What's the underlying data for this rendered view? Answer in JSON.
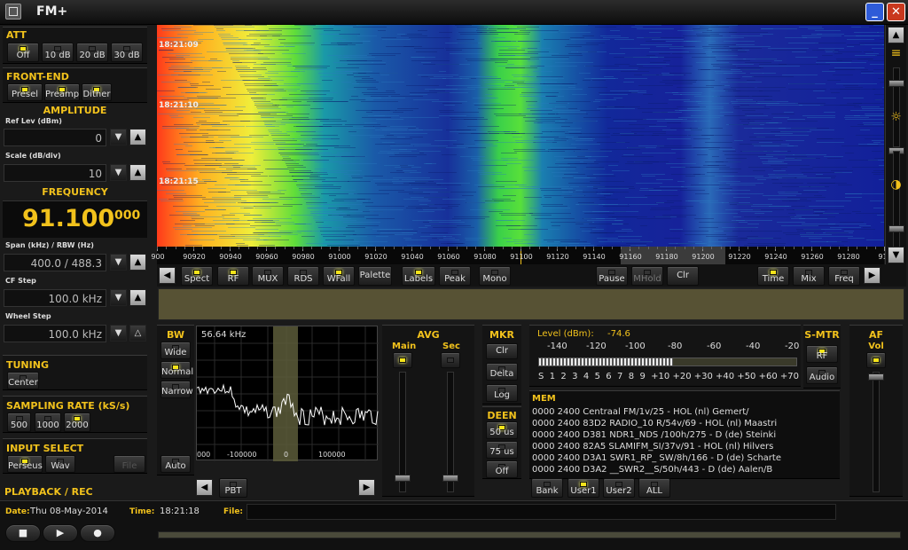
{
  "window": {
    "title": "FM+",
    "min_label": "_",
    "close_label": "✕"
  },
  "att": {
    "header": "ATT",
    "buttons": [
      "Off",
      "10 dB",
      "20 dB",
      "30 dB"
    ],
    "active": "Off"
  },
  "front_end": {
    "header": "FRONT-END",
    "buttons": [
      "Presel",
      "Preamp",
      "Dither"
    ]
  },
  "amplitude": {
    "header": "AMPLITUDE",
    "ref_label": "Ref Lev (dBm)",
    "ref_value": "0",
    "scale_label": "Scale (dB/div)",
    "scale_value": "10"
  },
  "frequency": {
    "header": "FREQUENCY",
    "main": "91.100",
    "sub": "000",
    "span_label": "Span (kHz) / RBW (Hz)",
    "span_value": "400.0 / 488.3",
    "cf_label": "CF Step",
    "cf_value": "100.0 kHz",
    "wheel_label": "Wheel Step",
    "wheel_value": "100.0 kHz"
  },
  "tuning": {
    "header": "TUNING",
    "center": "Center"
  },
  "sampling": {
    "header": "SAMPLING RATE (kS/s)",
    "buttons": [
      "500",
      "1000",
      "2000"
    ]
  },
  "input_select": {
    "header": "INPUT SELECT",
    "buttons": [
      "Perseus",
      "Wav",
      "File"
    ]
  },
  "playback": {
    "header": "PLAYBACK / REC",
    "date_label": "Date:",
    "date": "Thu 08-May-2014",
    "time_label": "Time:",
    "time": "18:21:18",
    "file_label": "File:"
  },
  "waterfall": {
    "timestamps": [
      "18:21:09",
      "18:21:10",
      "18:21:15"
    ]
  },
  "freq_scale": {
    "ticks": [
      "900",
      "90920",
      "90940",
      "90960",
      "90980",
      "91000",
      "91020",
      "91040",
      "91060",
      "91080",
      "91100",
      "91120",
      "91140",
      "91160",
      "91180",
      "91200",
      "91220",
      "91240",
      "91260",
      "91280",
      "913"
    ]
  },
  "spectrum_bar": {
    "left": [
      "Spect",
      "RF",
      "MUX",
      "RDS",
      "WFall",
      "Palette",
      "Labels",
      "Peak",
      "Mono"
    ],
    "right": [
      "Pause",
      "MHold",
      "Clr",
      "Time",
      "Mix",
      "Freq"
    ]
  },
  "bw": {
    "header": "BW",
    "buttons": [
      "Wide",
      "Normal",
      "Narrow"
    ],
    "auto": "Auto",
    "plot_label": "56.64 kHz",
    "x_ticks": [
      "000",
      "-100000",
      "0",
      "100000"
    ],
    "pbt": "PBT"
  },
  "avg": {
    "header": "AVG",
    "main": "Main",
    "sec": "Sec"
  },
  "mkr": {
    "header": "MKR",
    "buttons": [
      "Clr",
      "Delta",
      "Log"
    ]
  },
  "deen": {
    "header": "DEEN",
    "buttons": [
      "50 us",
      "75 us",
      "Off"
    ]
  },
  "level": {
    "label": "Level (dBm):",
    "value": "-74.6",
    "level_fraction": 0.52,
    "scale_top": [
      "-140",
      "-120",
      "-100",
      "-80",
      "-60",
      "-40",
      "-20"
    ],
    "scale_bottom": "S  1  2  3  4  5  6  7  8  9  +10 +20 +30 +40 +50 +60 +70"
  },
  "smtr": {
    "header": "S-MTR",
    "buttons": [
      "RF",
      "Audio"
    ]
  },
  "af": {
    "header": "AF",
    "vol": "Vol"
  },
  "mem": {
    "header": "MEM",
    "rows": [
      "0000 2400 Centraal FM/1v/25  - HOL (nl)  Gemert/",
      "0000 2400 83D2 RADIO_10 R/54v/69  - HOL (nl)  Maastri",
      "0000 2400 D381 NDR1_NDS /100h/275  - D (de)  Steinki",
      "0000 2400 82A5 SLAMIFM_SI/37v/91  - HOL (nl)  Hilvers",
      "0000 2400 D3A1 SWR1_RP_ SW/8h/166  - D (de)  Scharte",
      "0000 2400 D3A2 __SWR2__S/50h/443  - D (de)  Aalen/B"
    ],
    "buttons": [
      "Bank",
      "User1",
      "User2",
      "ALL"
    ]
  }
}
